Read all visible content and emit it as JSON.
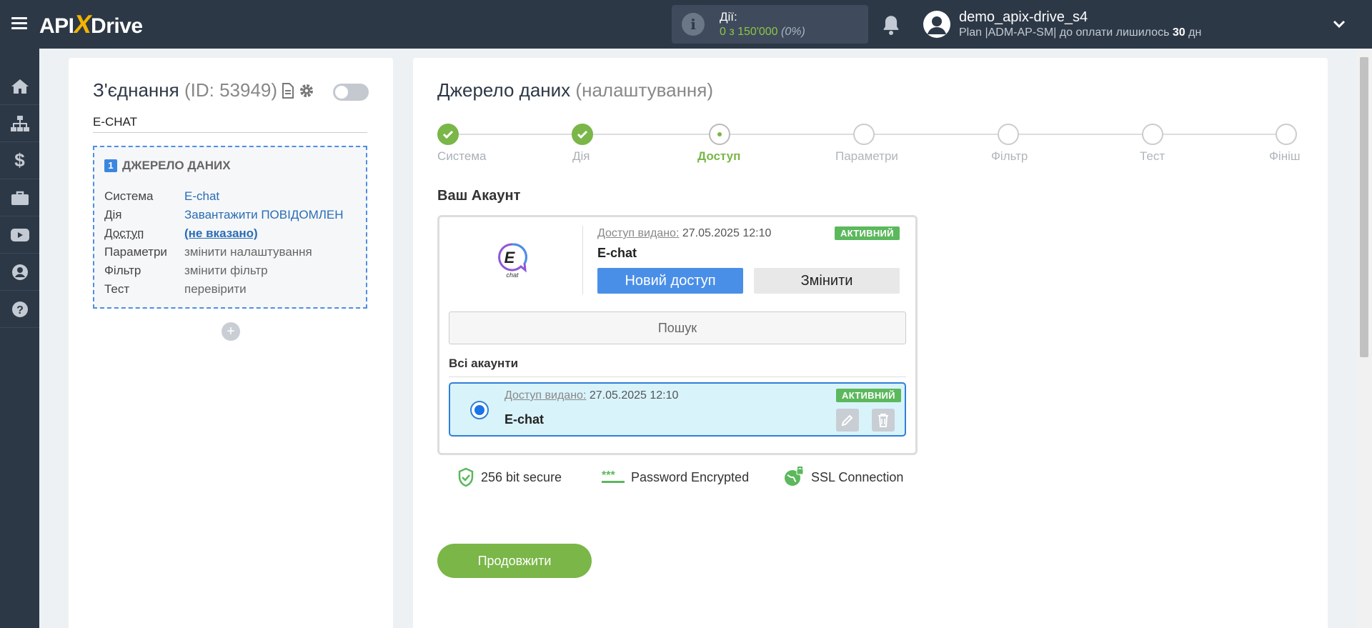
{
  "header": {
    "logo_left": "API",
    "logo_x": "X",
    "logo_right": "Drive",
    "actions_label": "Дії:",
    "actions_count": "0 з 150'000",
    "actions_percent": "(0%)",
    "user_name": "demo_apix-drive_s4",
    "plan_text": "Plan |ADM-AP-SM| до оплати лишилось",
    "plan_days": "30",
    "plan_days_unit": "дн"
  },
  "sidebar": {
    "items": [
      "home-icon",
      "sitemap-icon",
      "dollar-icon",
      "briefcase-icon",
      "youtube-icon",
      "user-icon",
      "help-icon"
    ]
  },
  "connection": {
    "title": "З'єднання",
    "id_text": "(ID: 53949)",
    "name": "E-CHAT",
    "source": {
      "number": "1",
      "heading": "ДЖЕРЕЛО ДАНИХ",
      "rows": [
        {
          "key": "Система",
          "value": "E-chat"
        },
        {
          "key": "Дія",
          "value": "Завантажити ПОВІДОМЛЕН"
        },
        {
          "key": "Доступ",
          "value": "(не вказано)"
        },
        {
          "key": "Параметри",
          "value": "змінити налаштування"
        },
        {
          "key": "Фільтр",
          "value": "змінити фільтр"
        },
        {
          "key": "Тест",
          "value": "перевірити"
        }
      ]
    },
    "add_label": "+"
  },
  "main": {
    "title": "Джерело даних",
    "subtitle": "(налаштування)",
    "steps": [
      {
        "label": "Система",
        "state": "done"
      },
      {
        "label": "Дія",
        "state": "done"
      },
      {
        "label": "Доступ",
        "state": "current"
      },
      {
        "label": "Параметри",
        "state": "todo"
      },
      {
        "label": "Фільтр",
        "state": "todo"
      },
      {
        "label": "Тест",
        "state": "todo"
      },
      {
        "label": "Фініш",
        "state": "todo"
      }
    ],
    "account_heading": "Ваш Акаунт",
    "account": {
      "granted_label": "Доступ видано:",
      "granted_date": "27.05.2025 12:10",
      "badge": "АКТИВНИЙ",
      "name": "E-chat",
      "logo_letter": "E",
      "logo_text": "chat",
      "new_access_button": "Новий доступ",
      "change_button": "Змінити"
    },
    "search_placeholder": "Пошук",
    "all_accounts_label": "Всі акаунти",
    "list": [
      {
        "granted_label": "Доступ видано:",
        "granted_date": "27.05.2025 12:10",
        "badge": "АКТИВНИЙ",
        "name": "E-chat"
      }
    ],
    "security": {
      "bit": "256 bit secure",
      "password_stars": "***",
      "password": "Password Encrypted",
      "ssl": "SSL Connection"
    },
    "continue_button": "Продовжити"
  },
  "colors": {
    "topbar": "#2d3847",
    "accent_green": "#7ab648",
    "accent_blue": "#4a8fe7",
    "badge_green": "#5cb85c"
  }
}
